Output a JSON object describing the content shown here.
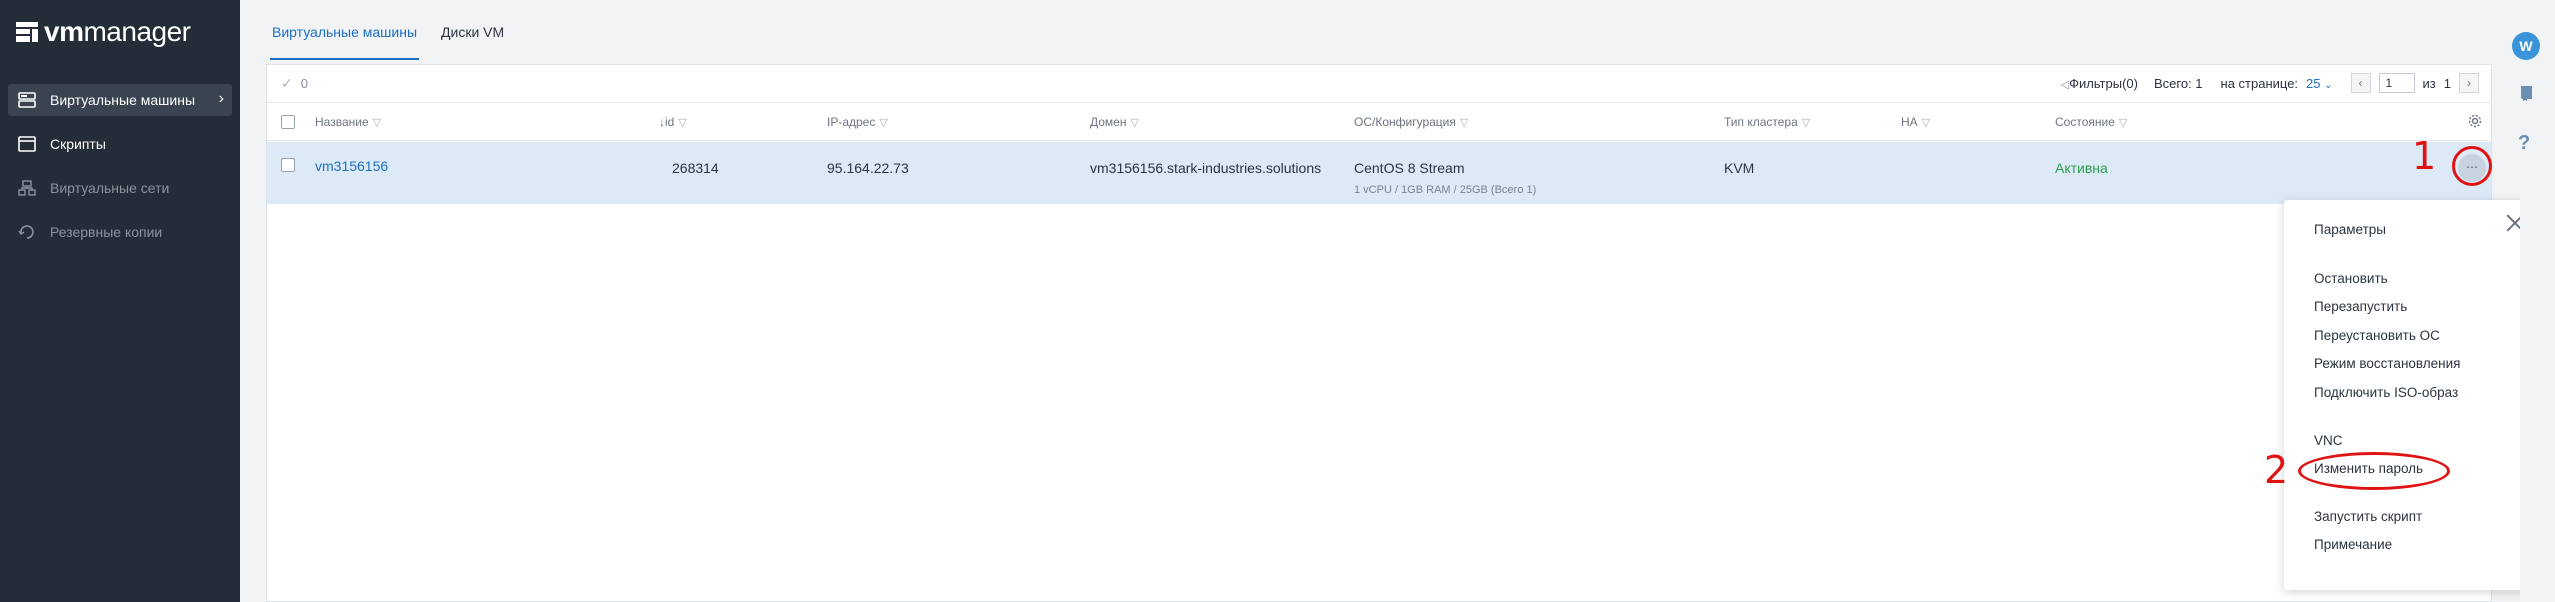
{
  "app": {
    "logo_prefix": "vm",
    "logo_suffix": "manager"
  },
  "sidebar": {
    "items": [
      {
        "label": "Виртуальные машины",
        "icon": "server-icon"
      },
      {
        "label": "Скрипты",
        "icon": "script-icon"
      },
      {
        "label": "Виртуальные сети",
        "icon": "network-icon"
      },
      {
        "label": "Резервные копии",
        "icon": "backup-icon"
      }
    ]
  },
  "tabs": [
    {
      "label": "Виртуальные машины"
    },
    {
      "label": "Диски VM"
    }
  ],
  "toolbar": {
    "selected": "0",
    "filters": "Фильтры(0)",
    "total": "Всего: 1",
    "per_page_label": "на странице:",
    "per_page_value": "25",
    "page": "1",
    "of_label": "из",
    "of_value": "1"
  },
  "table": {
    "columns": [
      "Название",
      "id",
      "IP-адрес",
      "Домен",
      "ОС/Конфигурация",
      "Тип кластера",
      "HA",
      "Состояние"
    ],
    "rows": [
      {
        "name": "vm3156156",
        "id": "268314",
        "ip": "95.164.22.73",
        "domain": "vm3156156.stark-industries.solutions",
        "os": "CentOS 8 Stream",
        "config": "1 vCPU / 1GB RAM / 25GB (Всего 1)",
        "cluster": "KVM",
        "ha": "",
        "state": "Активна"
      }
    ]
  },
  "menu": {
    "items": [
      "Параметры",
      "Остановить",
      "Перезапустить",
      "Переустановить ОС",
      "Режим восстановления",
      "Подключить ISO-образ",
      "VNC",
      "Изменить пароль",
      "Запустить скрипт",
      "Примечание"
    ]
  },
  "annotations": {
    "one": "1",
    "two": "2"
  },
  "user": {
    "avatar_letter": "W"
  },
  "colors": {
    "sidebar": "#242d37",
    "accent": "#1e6fc4",
    "row_selected": "#dceaf8",
    "status_active": "#2e9e4e",
    "annotation": "#e01313"
  }
}
